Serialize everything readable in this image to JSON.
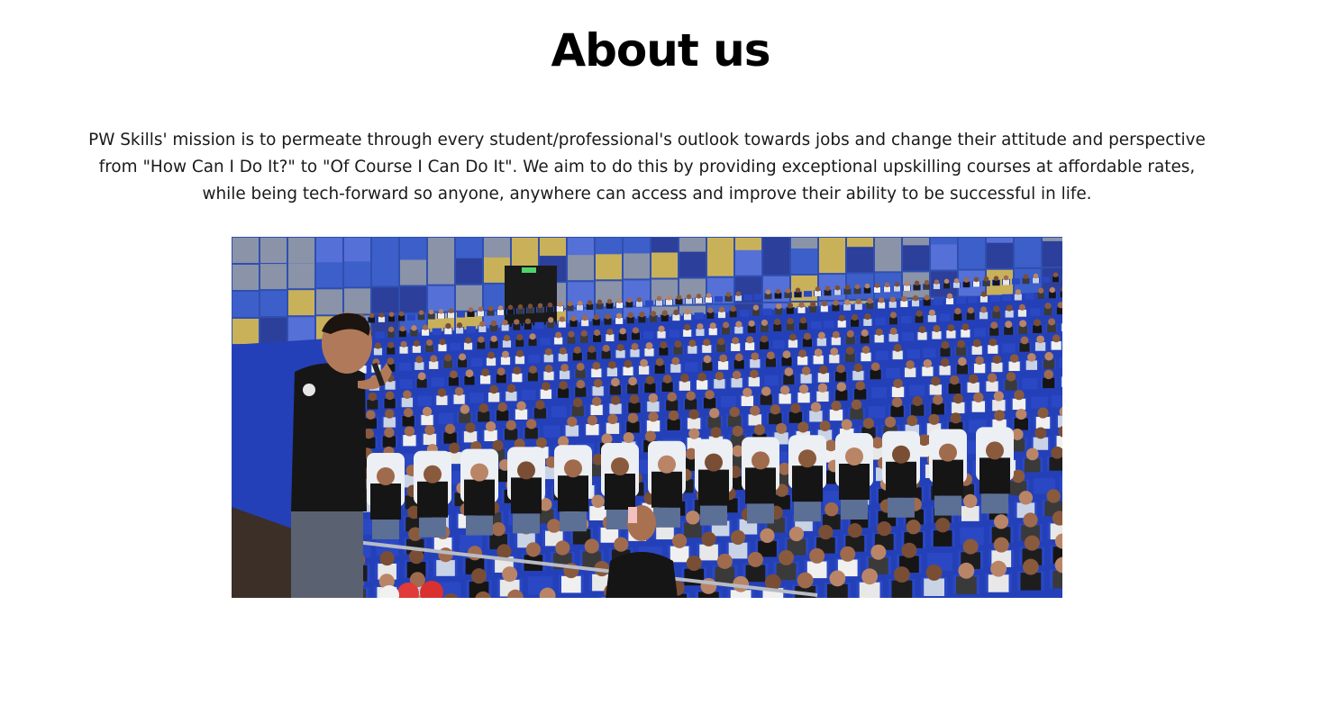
{
  "section": {
    "title": "About us",
    "mission_text": "PW Skills' mission is to permeate through every student/professional's outlook towards jobs and change their attitude and perspective from \"How Can I Do It?\" to \"Of Course I Can Do It\". We aim to do this by providing exceptional upskilling courses at affordable rates, while being tech-forward so anyone, anywhere can access and improve their ability to be successful in life."
  },
  "image": {
    "subject": "speaker-addressing-auditorium-audience",
    "colors": {
      "wall_blue": "#3d5fc9",
      "wall_yellow": "#c9b15a",
      "wall_grey": "#8a93a8",
      "seat_blue": "#2a48c4",
      "seat_white": "#eceff3",
      "shirt_black": "#151515",
      "skin": "#b07a5a"
    }
  }
}
